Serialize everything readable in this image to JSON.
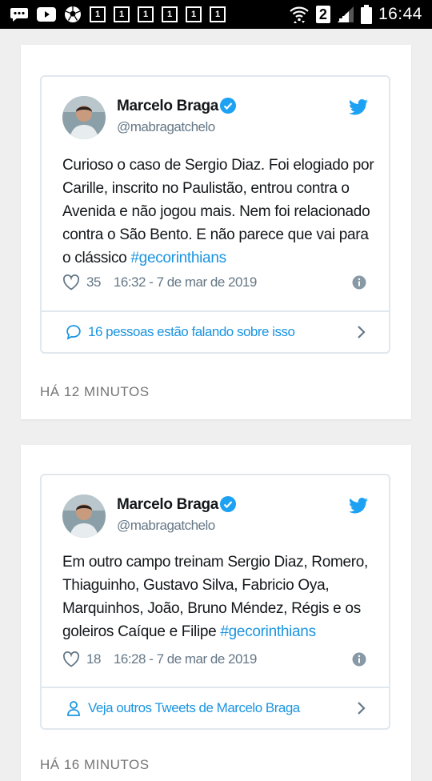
{
  "status_bar": {
    "time": "16:44",
    "notification_badge": "2",
    "box_icons": [
      "1",
      "1",
      "1",
      "1",
      "1",
      "1"
    ],
    "icons": [
      "chat-bubble-icon",
      "youtube-icon",
      "soccer-ball-icon",
      "wifi-icon",
      "signal-icon",
      "battery-icon"
    ]
  },
  "cards": [
    {
      "tweet": {
        "author_name": "Marcelo Braga",
        "handle": "@mabragatchelo",
        "text": "Curioso o caso de Sergio Diaz. Foi elogiado por Carille, inscrito no Paulistão, entrou contra o Avenida e não jogou mais. Nem foi relacionado contra o São Bento. E não parece que vai para o clássico ",
        "hashtag": "#gecorinthians",
        "likes": "35",
        "timestamp": "16:32 - 7 de mar de 2019",
        "footer": "16 pessoas estão falando sobre isso"
      },
      "time_ago": "HÁ 12 MINUTOS"
    },
    {
      "tweet": {
        "author_name": "Marcelo Braga",
        "handle": "@mabragatchelo",
        "text": "Em outro campo treinam Sergio Diaz, Romero, Thiaguinho, Gustavo Silva, Fabricio Oya, Marquinhos, João, Bruno Méndez, Régis e os goleiros Caíque e Filipe ",
        "hashtag": "#gecorinthians",
        "likes": "18",
        "timestamp": "16:28 - 7 de mar de 2019",
        "footer": "Veja outros Tweets de Marcelo Braga"
      },
      "time_ago": "HÁ 16 MINUTOS"
    }
  ],
  "colors": {
    "twitter_blue": "#1b95e0",
    "text": "#14171a",
    "muted": "#657786",
    "border": "#e1e8ed",
    "page_bg": "#efefef"
  }
}
